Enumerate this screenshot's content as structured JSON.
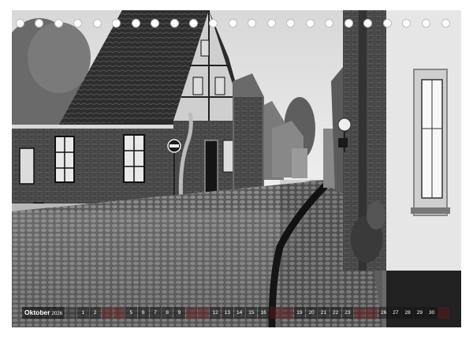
{
  "calendar": {
    "month": "Oktober",
    "year": "2026",
    "days": [
      {
        "label": "",
        "weekend": false
      },
      {
        "label": "1",
        "weekend": false
      },
      {
        "label": "2",
        "weekend": false
      },
      {
        "label": "",
        "weekend": true
      },
      {
        "label": "",
        "weekend": true
      },
      {
        "label": "5",
        "weekend": false
      },
      {
        "label": "6",
        "weekend": false
      },
      {
        "label": "7",
        "weekend": false
      },
      {
        "label": "8",
        "weekend": false
      },
      {
        "label": "9",
        "weekend": false
      },
      {
        "label": "",
        "weekend": true
      },
      {
        "label": "",
        "weekend": true
      },
      {
        "label": "12",
        "weekend": false
      },
      {
        "label": "13",
        "weekend": false
      },
      {
        "label": "14",
        "weekend": false
      },
      {
        "label": "15",
        "weekend": false
      },
      {
        "label": "16",
        "weekend": false
      },
      {
        "label": "",
        "weekend": true
      },
      {
        "label": "",
        "weekend": true
      },
      {
        "label": "19",
        "weekend": false
      },
      {
        "label": "20",
        "weekend": false
      },
      {
        "label": "21",
        "weekend": false
      },
      {
        "label": "22",
        "weekend": false
      },
      {
        "label": "23",
        "weekend": false
      },
      {
        "label": "",
        "weekend": true
      },
      {
        "label": "",
        "weekend": true
      },
      {
        "label": "26",
        "weekend": false
      },
      {
        "label": "27",
        "weekend": false
      },
      {
        "label": "28",
        "weekend": false
      },
      {
        "label": "29",
        "weekend": false
      },
      {
        "label": "30",
        "weekend": false
      },
      {
        "label": "",
        "weekend": true
      }
    ]
  },
  "photo": {
    "icons": [
      "no-entry-sign-icon",
      "street-lamp-icon"
    ]
  },
  "colors": {
    "strip": "#1e1e1e",
    "weekend": "#6a2a2a",
    "binding_hole": "#ffffff"
  }
}
